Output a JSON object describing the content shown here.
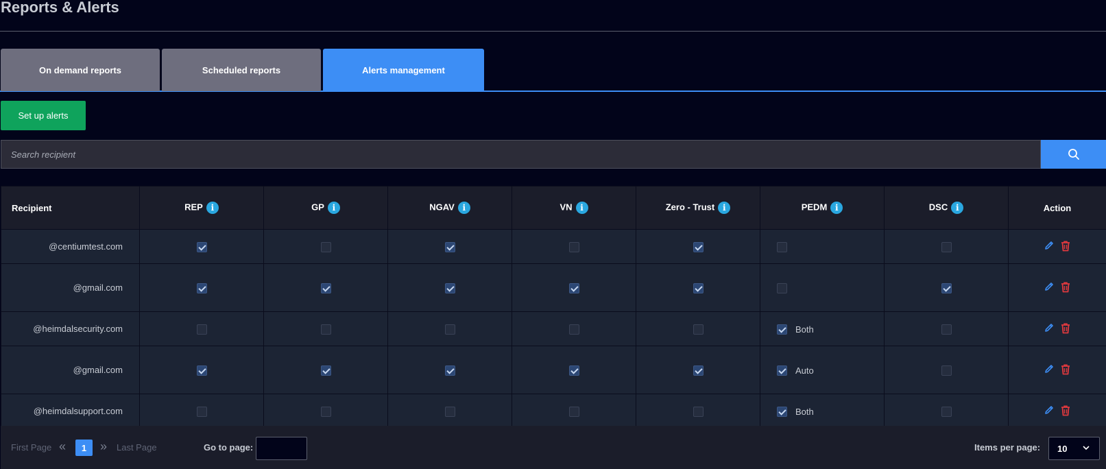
{
  "page": {
    "title": "Reports & Alerts"
  },
  "tabs": [
    {
      "label": "On demand reports",
      "active": false
    },
    {
      "label": "Scheduled reports",
      "active": false
    },
    {
      "label": "Alerts management",
      "active": true
    }
  ],
  "toolbar": {
    "setup_label": "Set up alerts"
  },
  "search": {
    "placeholder": "Search recipient",
    "value": ""
  },
  "table": {
    "headers": [
      "Recipient",
      "REP",
      "GP",
      "NGAV",
      "VN",
      "Zero - Trust",
      "PEDM",
      "DSC",
      "Action"
    ],
    "rows": [
      {
        "recipient": "@centiumtest.com",
        "rep": true,
        "gp": false,
        "ngav": true,
        "vn": false,
        "zt": true,
        "pedm": false,
        "pedm_label": "",
        "dsc": false
      },
      {
        "recipient": "@gmail.com",
        "rep": true,
        "gp": true,
        "ngav": true,
        "vn": true,
        "zt": true,
        "pedm": false,
        "pedm_label": "",
        "dsc": true
      },
      {
        "recipient": "@heimdalsecurity.com",
        "rep": false,
        "gp": false,
        "ngav": false,
        "vn": false,
        "zt": false,
        "pedm": true,
        "pedm_label": "Both",
        "dsc": false
      },
      {
        "recipient": "@gmail.com",
        "rep": true,
        "gp": true,
        "ngav": true,
        "vn": true,
        "zt": true,
        "pedm": true,
        "pedm_label": "Auto",
        "dsc": false
      },
      {
        "recipient": "@heimdalsupport.com",
        "rep": false,
        "gp": false,
        "ngav": false,
        "vn": false,
        "zt": false,
        "pedm": true,
        "pedm_label": "Both",
        "dsc": false
      }
    ]
  },
  "pager": {
    "first": "First Page",
    "last": "Last Page",
    "current_page": "1",
    "goto_label": "Go to page:",
    "goto_value": "",
    "items_per_page_label": "Items per page:",
    "items_per_page": "10"
  },
  "colors": {
    "accent": "#3d8ef5",
    "success": "#0fa35c",
    "danger": "#e0393e",
    "info": "#2aa7e0"
  },
  "icons": {
    "search": "search-icon",
    "info": "info-icon",
    "edit": "pencil-icon",
    "delete": "trash-icon",
    "prev": "double-chevron-left-icon",
    "next": "double-chevron-right-icon",
    "dropdown": "chevron-down-icon"
  }
}
